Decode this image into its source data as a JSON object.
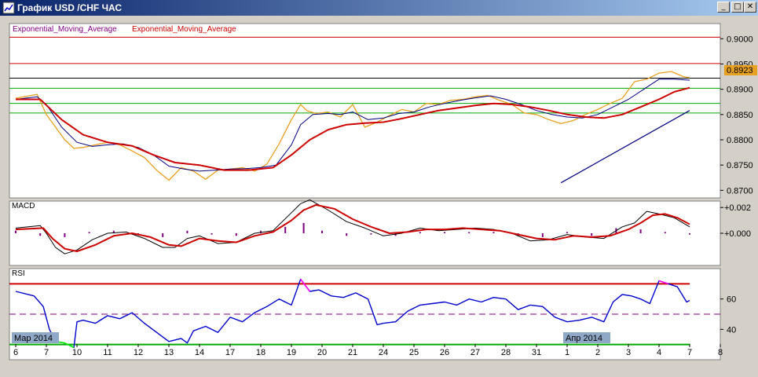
{
  "window": {
    "title": "График USD /CHF ЧАС",
    "buttons": {
      "minimize": "_",
      "restore": "□",
      "close": "✕"
    }
  },
  "colors": {
    "price": "#e8a020",
    "ema_fast": "#000080",
    "ema_slow": "#cc0000",
    "trendline": "#000080",
    "red_level": "#cc0000",
    "green_level": "#00aa00",
    "black_level": "#000000",
    "macd_hist": "#800080",
    "rsi": "#0000cc",
    "rsi_over": "#ff00ff",
    "rsi_under": "#00ee00",
    "current_price_bg": "#e8a020"
  },
  "chart_data": [
    {
      "type": "line",
      "panel": "price",
      "legend": [
        "Exponential_Moving_Average",
        "Exponential_Moving_Average"
      ],
      "ylim": [
        0.8685,
        0.903
      ],
      "yticks": [
        "0.9000",
        "0.8950",
        "0.8900",
        "0.8850",
        "0.8800",
        "0.8750",
        "0.8700"
      ],
      "current_price": "0.8923",
      "levels": {
        "red": [
          0.9003,
          0.8951
        ],
        "black": [
          0.8922
        ],
        "green": [
          0.8902,
          0.8872,
          0.8853
        ]
      },
      "trendline": {
        "from": [
          17.8,
          0.8715
        ],
        "to": [
          22.0,
          0.8858
        ]
      },
      "series": [
        {
          "name": "price",
          "x": [
            0,
            0.7,
            1.0,
            1.3,
            1.6,
            1.9,
            2.2,
            2.6,
            3.0,
            3.4,
            3.8,
            4.2,
            4.6,
            5.0,
            5.4,
            5.8,
            6.2,
            6.6,
            7.0,
            7.4,
            7.8,
            8.2,
            8.6,
            9.0,
            9.3,
            9.5,
            9.8,
            10.2,
            10.6,
            11.0,
            11.4,
            11.8,
            12.2,
            12.6,
            13.0,
            13.4,
            13.8,
            14.2,
            14.6,
            15.0,
            15.4,
            15.8,
            16.2,
            16.6,
            17.0,
            17.4,
            17.8,
            18.2,
            18.6,
            19.0,
            19.4,
            19.8,
            20.2,
            20.6,
            21.0,
            21.4,
            21.8,
            22.0
          ],
          "values": [
            0.8882,
            0.889,
            0.885,
            0.8825,
            0.88,
            0.8783,
            0.8785,
            0.879,
            0.8795,
            0.879,
            0.8778,
            0.8765,
            0.874,
            0.872,
            0.8745,
            0.8738,
            0.8722,
            0.874,
            0.8742,
            0.8745,
            0.8738,
            0.8752,
            0.8792,
            0.884,
            0.887,
            0.8858,
            0.8852,
            0.8855,
            0.8845,
            0.887,
            0.8825,
            0.8835,
            0.8848,
            0.886,
            0.8855,
            0.8872,
            0.887,
            0.8878,
            0.888,
            0.8885,
            0.8888,
            0.8878,
            0.887,
            0.8853,
            0.885,
            0.884,
            0.8832,
            0.8838,
            0.885,
            0.886,
            0.8872,
            0.8882,
            0.8915,
            0.892,
            0.8932,
            0.8935,
            0.8925,
            0.8923
          ]
        },
        {
          "name": "ema_fast",
          "x": [
            0,
            0.7,
            1.0,
            1.5,
            2.0,
            2.5,
            3.0,
            3.5,
            4.0,
            4.5,
            5.0,
            5.5,
            6.0,
            6.5,
            7.0,
            7.5,
            8.0,
            8.5,
            9.0,
            9.3,
            9.7,
            10.2,
            10.6,
            11.0,
            11.5,
            12.0,
            12.5,
            13.0,
            13.5,
            14.0,
            14.5,
            15.0,
            15.5,
            16.0,
            16.5,
            17.0,
            17.5,
            18.0,
            18.5,
            19.0,
            19.5,
            20.0,
            20.5,
            21.0,
            21.5,
            22.0
          ],
          "values": [
            0.888,
            0.8885,
            0.887,
            0.8825,
            0.8795,
            0.8787,
            0.879,
            0.8792,
            0.8785,
            0.877,
            0.8748,
            0.8742,
            0.8738,
            0.874,
            0.8742,
            0.8743,
            0.8745,
            0.875,
            0.879,
            0.883,
            0.885,
            0.8852,
            0.885,
            0.8855,
            0.884,
            0.8843,
            0.8852,
            0.8855,
            0.8865,
            0.8872,
            0.8878,
            0.8883,
            0.8887,
            0.888,
            0.887,
            0.8858,
            0.885,
            0.8845,
            0.8843,
            0.885,
            0.8865,
            0.888,
            0.89,
            0.892,
            0.892,
            0.8918
          ]
        },
        {
          "name": "ema_slow",
          "x": [
            0,
            0.8,
            1.5,
            2.2,
            3.0,
            3.8,
            4.5,
            5.2,
            6.0,
            6.8,
            7.6,
            8.4,
            9.0,
            9.6,
            10.2,
            10.8,
            11.4,
            12.0,
            12.6,
            13.2,
            13.8,
            14.4,
            15.0,
            15.6,
            16.2,
            16.8,
            17.4,
            18.0,
            18.6,
            19.2,
            19.8,
            20.4,
            21.0,
            21.5,
            22.0
          ],
          "values": [
            0.888,
            0.888,
            0.884,
            0.881,
            0.8795,
            0.8788,
            0.877,
            0.8755,
            0.875,
            0.874,
            0.874,
            0.8745,
            0.877,
            0.88,
            0.882,
            0.883,
            0.8833,
            0.8835,
            0.8842,
            0.885,
            0.8858,
            0.8863,
            0.8868,
            0.8872,
            0.887,
            0.8865,
            0.8858,
            0.885,
            0.8845,
            0.8843,
            0.885,
            0.8865,
            0.888,
            0.8895,
            0.8903
          ]
        }
      ]
    },
    {
      "type": "line",
      "panel": "macd",
      "label": "MACD",
      "ylim": [
        -0.0025,
        0.0025
      ],
      "yticks": [
        "+0.002",
        "+0.000"
      ],
      "series": [
        {
          "name": "macd",
          "x": [
            0,
            0.8,
            1.0,
            1.3,
            1.6,
            2.0,
            2.5,
            3.0,
            3.6,
            4.2,
            4.8,
            5.2,
            5.6,
            6.0,
            6.6,
            7.2,
            7.8,
            8.4,
            9.0,
            9.3,
            9.6,
            10.2,
            10.8,
            11.4,
            12.0,
            12.6,
            13.2,
            13.8,
            14.4,
            15.0,
            15.6,
            16.2,
            16.8,
            17.4,
            18.0,
            18.6,
            19.2,
            19.8,
            20.2,
            20.6,
            21.0,
            21.5,
            22.0
          ],
          "values": [
            0.0004,
            0.0006,
            0.0,
            -0.0011,
            -0.0016,
            -0.0013,
            -0.0005,
            0.0,
            0.0001,
            -0.0004,
            -0.0011,
            -0.0011,
            -0.0004,
            -0.0002,
            -0.0008,
            -0.0007,
            0.0,
            0.0002,
            0.0016,
            0.0023,
            0.0026,
            0.0018,
            0.0009,
            0.0004,
            -0.0002,
            0.0,
            0.0004,
            0.0002,
            0.0003,
            0.0004,
            0.0003,
            0.0,
            -0.0006,
            -0.0005,
            -0.0001,
            -0.0003,
            -0.0004,
            0.0005,
            0.0008,
            0.0017,
            0.0015,
            0.0012,
            0.0005
          ]
        },
        {
          "name": "signal",
          "x": [
            0,
            0.9,
            1.2,
            1.6,
            2.0,
            2.6,
            3.2,
            3.8,
            4.4,
            5.0,
            5.4,
            6.0,
            6.6,
            7.2,
            7.8,
            8.4,
            9.0,
            9.4,
            9.8,
            10.4,
            11.0,
            11.6,
            12.2,
            12.8,
            13.4,
            14.0,
            14.6,
            15.2,
            15.8,
            16.4,
            17.0,
            17.6,
            18.2,
            18.8,
            19.4,
            20.0,
            20.4,
            20.8,
            21.2,
            21.6,
            22.0
          ],
          "values": [
            0.0003,
            0.0004,
            -0.0004,
            -0.0012,
            -0.0014,
            -0.0009,
            -0.0002,
            0.0,
            -0.0003,
            -0.0009,
            -0.001,
            -0.0004,
            -0.0006,
            -0.0007,
            -0.0002,
            0.0001,
            0.001,
            0.0018,
            0.0022,
            0.0019,
            0.0011,
            0.0005,
            0.0,
            0.0001,
            0.0003,
            0.0003,
            0.0004,
            0.0003,
            0.0002,
            -0.0001,
            -0.0004,
            -0.0005,
            -0.0002,
            -0.0003,
            -0.0002,
            0.0003,
            0.0008,
            0.0014,
            0.0015,
            0.0012,
            0.0007
          ]
        },
        {
          "name": "histogram",
          "x": [
            0,
            0.8,
            1.6,
            2.4,
            3.2,
            4.0,
            4.8,
            5.6,
            6.4,
            7.2,
            8.0,
            8.8,
            9.4,
            10.0,
            10.8,
            11.6,
            12.4,
            13.2,
            14.0,
            14.8,
            15.6,
            16.4,
            17.2,
            18.0,
            18.8,
            19.6,
            20.4,
            21.2,
            22.0
          ],
          "values": [
            0.0002,
            -0.0002,
            -0.0003,
            0.0001,
            0.0002,
            -0.0001,
            -0.0003,
            0.0002,
            -0.0001,
            -0.0002,
            0.0002,
            0.0005,
            0.0008,
            0.0002,
            -0.0002,
            -0.0001,
            -0.0002,
            0.0001,
            0.0001,
            0.0001,
            0.0001,
            -0.0002,
            -0.0003,
            0.0001,
            -0.0002,
            0.0004,
            0.0003,
            0.0001,
            -0.0001
          ]
        }
      ]
    },
    {
      "type": "line",
      "panel": "rsi",
      "label": "RSI",
      "ylim": [
        20,
        80
      ],
      "yticks": [
        "60",
        "40"
      ],
      "levels": {
        "overbought": 70,
        "mid": 50,
        "oversold": 30
      },
      "series": [
        {
          "name": "rsi",
          "x": [
            0,
            0.6,
            0.9,
            1.1,
            1.3,
            1.6,
            1.9,
            2.0,
            2.2,
            2.6,
            3.0,
            3.4,
            3.8,
            4.2,
            4.6,
            5.0,
            5.4,
            5.6,
            5.8,
            6.2,
            6.6,
            7.0,
            7.4,
            7.8,
            8.2,
            8.6,
            9.0,
            9.3,
            9.6,
            9.9,
            10.3,
            10.7,
            11.1,
            11.5,
            11.8,
            12.0,
            12.4,
            12.8,
            13.2,
            13.6,
            14.0,
            14.4,
            14.8,
            15.2,
            15.6,
            16.0,
            16.4,
            16.8,
            17.2,
            17.6,
            18.0,
            18.4,
            18.8,
            19.2,
            19.5,
            19.8,
            20.1,
            20.4,
            20.7,
            21.0,
            21.3,
            21.6,
            21.9,
            22.0
          ],
          "values": [
            65,
            62,
            55,
            40,
            32,
            31,
            28,
            45,
            46,
            44,
            49,
            47,
            51,
            44,
            38,
            32,
            34,
            31,
            39,
            42,
            38,
            48,
            45,
            51,
            55,
            60,
            56,
            73,
            65,
            66,
            62,
            61,
            64,
            60,
            43,
            44,
            45,
            52,
            56,
            57,
            58,
            56,
            60,
            58,
            61,
            60,
            53,
            56,
            55,
            48,
            45,
            46,
            48,
            45,
            58,
            63,
            62,
            60,
            57,
            72,
            70,
            68,
            58,
            59
          ]
        }
      ],
      "highlights": [
        {
          "range": [
            9.3,
            9.6
          ],
          "zone": "overbought"
        },
        {
          "range": [
            21.0,
            21.4
          ],
          "zone": "overbought"
        },
        {
          "range": [
            1.3,
            1.9
          ],
          "zone": "oversold"
        }
      ]
    }
  ],
  "x_axis": {
    "ticks": [
      {
        "x": 0,
        "label": "6"
      },
      {
        "x": 1,
        "label": "7"
      },
      {
        "x": 2,
        "label": "10"
      },
      {
        "x": 3,
        "label": "11"
      },
      {
        "x": 4,
        "label": "12"
      },
      {
        "x": 5,
        "label": "13"
      },
      {
        "x": 6,
        "label": "14"
      },
      {
        "x": 7,
        "label": "17"
      },
      {
        "x": 8,
        "label": "18"
      },
      {
        "x": 9,
        "label": "19"
      },
      {
        "x": 10,
        "label": "20"
      },
      {
        "x": 11,
        "label": "21"
      },
      {
        "x": 12,
        "label": "24"
      },
      {
        "x": 13,
        "label": "25"
      },
      {
        "x": 14,
        "label": "26"
      },
      {
        "x": 15,
        "label": "27"
      },
      {
        "x": 16,
        "label": "28"
      },
      {
        "x": 17,
        "label": "31"
      },
      {
        "x": 18,
        "label": "1"
      },
      {
        "x": 19,
        "label": "2"
      },
      {
        "x": 20,
        "label": "3"
      },
      {
        "x": 21,
        "label": "4"
      },
      {
        "x": 22,
        "label": "7"
      },
      {
        "x": 23,
        "label": "8"
      }
    ],
    "month_labels": [
      {
        "x": 0,
        "label": "Мар 2014"
      },
      {
        "x": 18,
        "label": "Апр 2014"
      }
    ]
  }
}
